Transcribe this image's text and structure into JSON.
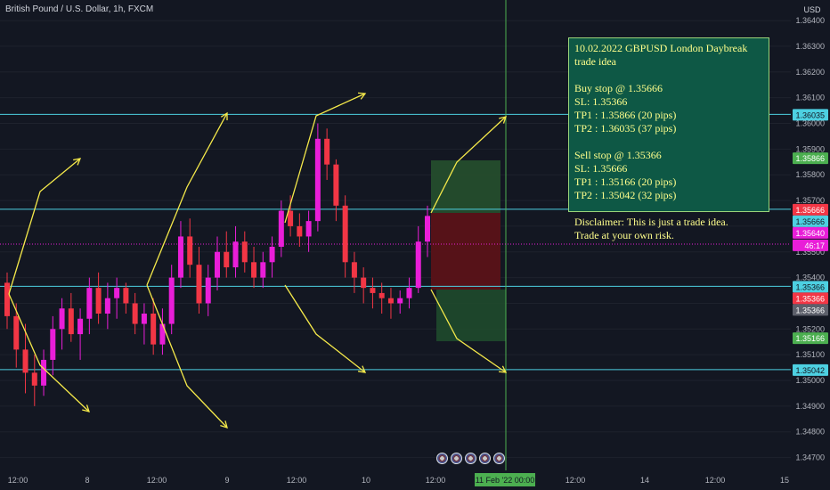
{
  "header": {
    "symbol_title": "British Pound / U.S. Dollar, 1h, FXCM"
  },
  "annotation": {
    "text": "10.02.2022 GBPUSD London Daybreak trade idea\n\nBuy stop @  1.35666\nSL: 1.35366\nTP1 : 1.35866 (20 pips)\nTP2 : 1.36035 (37 pips)\n\nSell stop @ 1.35366\nSL: 1.35666\nTP1 : 1.35166 (20 pips)\nTP2 : 1.35042 (32 pips)\n\nDisclaimer: This is just a trade idea.\nTrade at your own risk."
  },
  "colors": {
    "background": "#131722",
    "bull_candle": "#e91ed8",
    "bear_candle": "#f23645",
    "level_line": "#4dd0e1",
    "arrow": "#f5e94a",
    "crosshair": "#4caf50"
  },
  "chart_data": {
    "type": "candlestick",
    "title": "British Pound / U.S. Dollar, 1h, FXCM",
    "currency_label": "USD",
    "ylim": [
      1.3465,
      1.3648
    ],
    "y_ticks": [
      "1.36400",
      "1.36300",
      "1.36200",
      "1.36100",
      "1.36000",
      "1.35900",
      "1.35800",
      "1.35700",
      "1.35600",
      "1.35500",
      "1.35400",
      "1.35300",
      "1.35200",
      "1.35100",
      "1.35000",
      "1.34900",
      "1.34800",
      "1.34700"
    ],
    "x_ticks": [
      "12:00",
      "8",
      "12:00",
      "9",
      "12:00",
      "10",
      "12:00",
      "12:00",
      "14",
      "12:00",
      "15"
    ],
    "crosshair_label": "11 Feb '22   00:00",
    "horizontal_levels": [
      1.36035,
      1.35666,
      1.35366,
      1.35042
    ],
    "price_labels": [
      {
        "value": "1.36035",
        "color": "#4dd0e1",
        "text_color": "#131722"
      },
      {
        "value": "1.35866",
        "color": "#4caf50",
        "text_color": "#ffffff"
      },
      {
        "value": "1.35666",
        "color": "#f23645",
        "text_color": "#ffffff"
      },
      {
        "value": "1.35666",
        "color": "#4dd0e1",
        "text_color": "#131722"
      },
      {
        "value": "1.35640",
        "color": "#e91ed8",
        "text_color": "#ffffff"
      },
      {
        "value": "46:17",
        "color": "#e91ed8",
        "text_color": "#ffffff"
      },
      {
        "value": "1.35366",
        "color": "#4dd0e1",
        "text_color": "#131722"
      },
      {
        "value": "1.35366",
        "color": "#f23645",
        "text_color": "#ffffff"
      },
      {
        "value": "1.35366",
        "color": "#5d606b",
        "text_color": "#ffffff"
      },
      {
        "value": "1.35166",
        "color": "#4caf50",
        "text_color": "#ffffff"
      },
      {
        "value": "1.35042",
        "color": "#4dd0e1",
        "text_color": "#131722"
      }
    ],
    "current_price": 1.3564,
    "candles": [
      [
        1.3538,
        1.3542,
        1.352,
        1.3525
      ],
      [
        1.3525,
        1.353,
        1.3505,
        1.3512
      ],
      [
        1.3512,
        1.3522,
        1.3495,
        1.3503
      ],
      [
        1.3503,
        1.351,
        1.349,
        1.3498
      ],
      [
        1.3498,
        1.3512,
        1.3494,
        1.3508
      ],
      [
        1.3508,
        1.3525,
        1.3502,
        1.352
      ],
      [
        1.352,
        1.3532,
        1.3512,
        1.3528
      ],
      [
        1.3528,
        1.3534,
        1.3515,
        1.3518
      ],
      [
        1.3518,
        1.3528,
        1.3508,
        1.3524
      ],
      [
        1.3524,
        1.354,
        1.3518,
        1.3536
      ],
      [
        1.3536,
        1.3542,
        1.3522,
        1.3526
      ],
      [
        1.3526,
        1.3538,
        1.352,
        1.3532
      ],
      [
        1.3532,
        1.354,
        1.3524,
        1.3536
      ],
      [
        1.3536,
        1.3538,
        1.3526,
        1.353
      ],
      [
        1.353,
        1.3534,
        1.3518,
        1.3522
      ],
      [
        1.3522,
        1.353,
        1.3514,
        1.3526
      ],
      [
        1.3526,
        1.3532,
        1.351,
        1.3514
      ],
      [
        1.3514,
        1.3528,
        1.351,
        1.3522
      ],
      [
        1.3522,
        1.3545,
        1.3518,
        1.354
      ],
      [
        1.354,
        1.3562,
        1.3536,
        1.3556
      ],
      [
        1.3556,
        1.3563,
        1.354,
        1.3545
      ],
      [
        1.3545,
        1.3552,
        1.3526,
        1.353
      ],
      [
        1.353,
        1.3545,
        1.3525,
        1.354
      ],
      [
        1.354,
        1.3556,
        1.3535,
        1.355
      ],
      [
        1.355,
        1.3558,
        1.354,
        1.3544
      ],
      [
        1.3544,
        1.356,
        1.354,
        1.3554
      ],
      [
        1.3554,
        1.3558,
        1.3542,
        1.3546
      ],
      [
        1.3546,
        1.3552,
        1.3536,
        1.354
      ],
      [
        1.354,
        1.355,
        1.3536,
        1.3546
      ],
      [
        1.3546,
        1.3556,
        1.354,
        1.3552
      ],
      [
        1.3552,
        1.357,
        1.3548,
        1.3566
      ],
      [
        1.3566,
        1.3572,
        1.3556,
        1.356
      ],
      [
        1.356,
        1.3565,
        1.3552,
        1.3556
      ],
      [
        1.3556,
        1.3566,
        1.355,
        1.3562
      ],
      [
        1.3562,
        1.36,
        1.3558,
        1.3594
      ],
      [
        1.3594,
        1.3598,
        1.3578,
        1.3584
      ],
      [
        1.3584,
        1.3586,
        1.3562,
        1.3568
      ],
      [
        1.3568,
        1.3572,
        1.354,
        1.3546
      ],
      [
        1.3546,
        1.355,
        1.3534,
        1.354
      ],
      [
        1.354,
        1.3544,
        1.353,
        1.3536
      ],
      [
        1.3536,
        1.354,
        1.3528,
        1.3534
      ],
      [
        1.3534,
        1.3538,
        1.3526,
        1.3532
      ],
      [
        1.3532,
        1.3536,
        1.3524,
        1.353
      ],
      [
        1.353,
        1.3535,
        1.3526,
        1.3532
      ],
      [
        1.3532,
        1.354,
        1.3528,
        1.3536
      ],
      [
        1.3536,
        1.356,
        1.3534,
        1.3554
      ],
      [
        1.3554,
        1.3568,
        1.3548,
        1.3564
      ]
    ]
  }
}
